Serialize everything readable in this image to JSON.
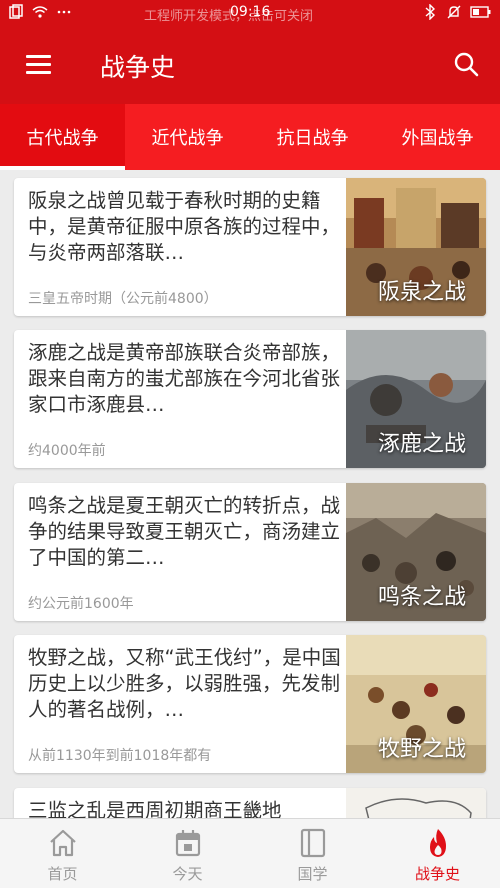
{
  "status_bar": {
    "notice": "工程师开发模式，点击可关闭",
    "time": "09:16"
  },
  "app_bar": {
    "title": "战争史"
  },
  "tabs": [
    {
      "label": "古代战争",
      "active": true
    },
    {
      "label": "近代战争",
      "active": false
    },
    {
      "label": "抗日战争",
      "active": false
    },
    {
      "label": "外国战争",
      "active": false
    }
  ],
  "articles": [
    {
      "summary": "阪泉之战曾见载于春秋时期的史籍中，是黄帝征服中原各族的过程中，与炎帝两部落联…",
      "era": "三皇五帝时期（公元前4800）",
      "title": "阪泉之战"
    },
    {
      "summary": "涿鹿之战是黄帝部族联合炎帝部族，跟来自南方的蚩尤部族在今河北省张家口市涿鹿县…",
      "era": "约4000年前",
      "title": "涿鹿之战"
    },
    {
      "summary": "鸣条之战是夏王朝灭亡的转折点，战争的结果导致夏王朝灭亡，商汤建立了中国的第二…",
      "era": "约公元前1600年",
      "title": "鸣条之战"
    },
    {
      "summary": "牧野之战，又称“武王伐纣”，是中国历史上以少胜多，以弱胜强，先发制人的著名战例，…",
      "era": "从前1130年到前1018年都有",
      "title": "牧野之战"
    },
    {
      "summary": "三监之乱是西周初期商王畿地",
      "era": "",
      "title": ""
    }
  ],
  "bottom_nav": [
    {
      "label": "首页",
      "icon": "home-icon",
      "active": false
    },
    {
      "label": "今天",
      "icon": "calendar-icon",
      "active": false
    },
    {
      "label": "国学",
      "icon": "book-icon",
      "active": false
    },
    {
      "label": "战争史",
      "icon": "flame-icon",
      "active": true
    }
  ],
  "colors": {
    "primary": "#d40f14",
    "tab_bar": "#f51d21",
    "active_nav": "#e01018"
  }
}
